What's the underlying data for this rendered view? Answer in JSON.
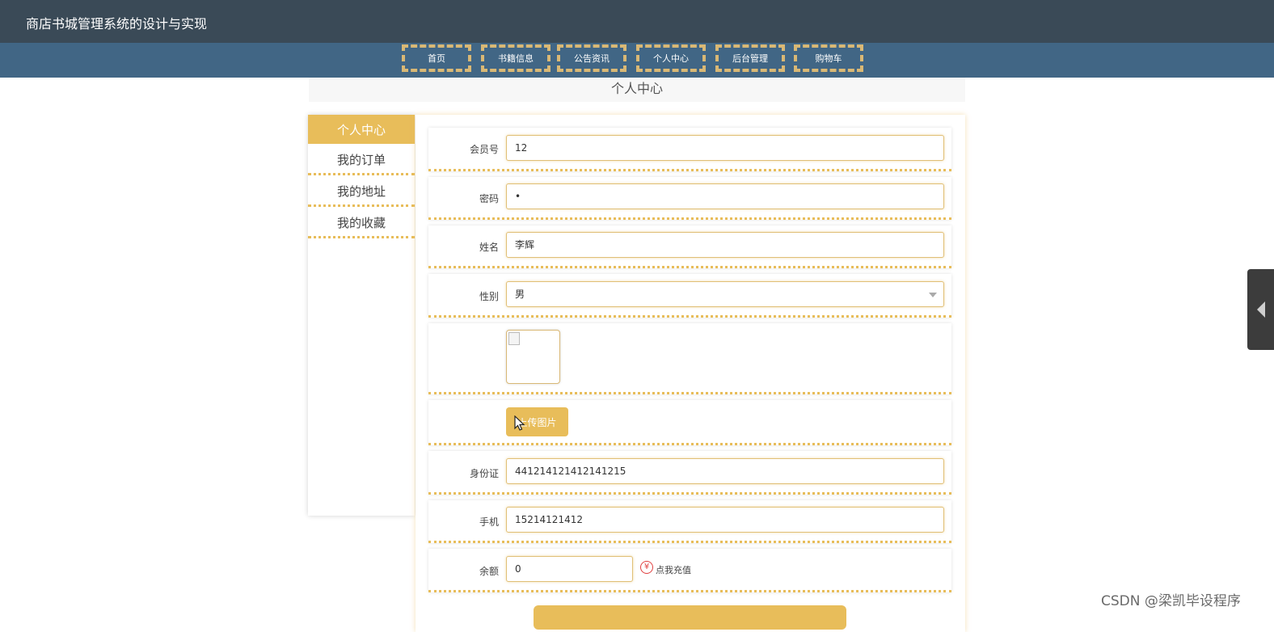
{
  "app": {
    "title": "商店书城管理系统的设计与实现"
  },
  "nav": {
    "items": [
      {
        "label": "首页"
      },
      {
        "label": "书籍信息"
      },
      {
        "label": "公告资讯"
      },
      {
        "label": "个人中心"
      },
      {
        "label": "后台管理"
      },
      {
        "label": "购物车"
      }
    ]
  },
  "page": {
    "section_title": "个人中心"
  },
  "sidebar": {
    "active": "个人中心",
    "items": [
      {
        "label": "我的订单"
      },
      {
        "label": "我的地址"
      },
      {
        "label": "我的收藏"
      }
    ]
  },
  "form": {
    "member_no": {
      "label": "会员号",
      "value": "12"
    },
    "password": {
      "label": "密码",
      "value": "•"
    },
    "name": {
      "label": "姓名",
      "value": "李辉"
    },
    "gender": {
      "label": "性别",
      "value": "男"
    },
    "upload_label": "上传图片",
    "id_card": {
      "label": "身份证",
      "value": "441214121412141215"
    },
    "phone": {
      "label": "手机",
      "value": "15214121412"
    },
    "balance": {
      "label": "余额",
      "value": "0"
    },
    "recharge_icon": "¥",
    "recharge_link": "点我充值"
  },
  "watermark": "CSDN @梁凯毕设程序",
  "colors": {
    "topbar": "#3a4a57",
    "navbar": "#416685",
    "accent": "#e8bd5a"
  },
  "icons": {
    "select_arrow": "chevron-down-icon",
    "broken_image": "image-placeholder-icon",
    "recharge": "yen-icon",
    "cursor": "mouse-cursor-icon",
    "side_tab": "chevron-left-icon"
  }
}
